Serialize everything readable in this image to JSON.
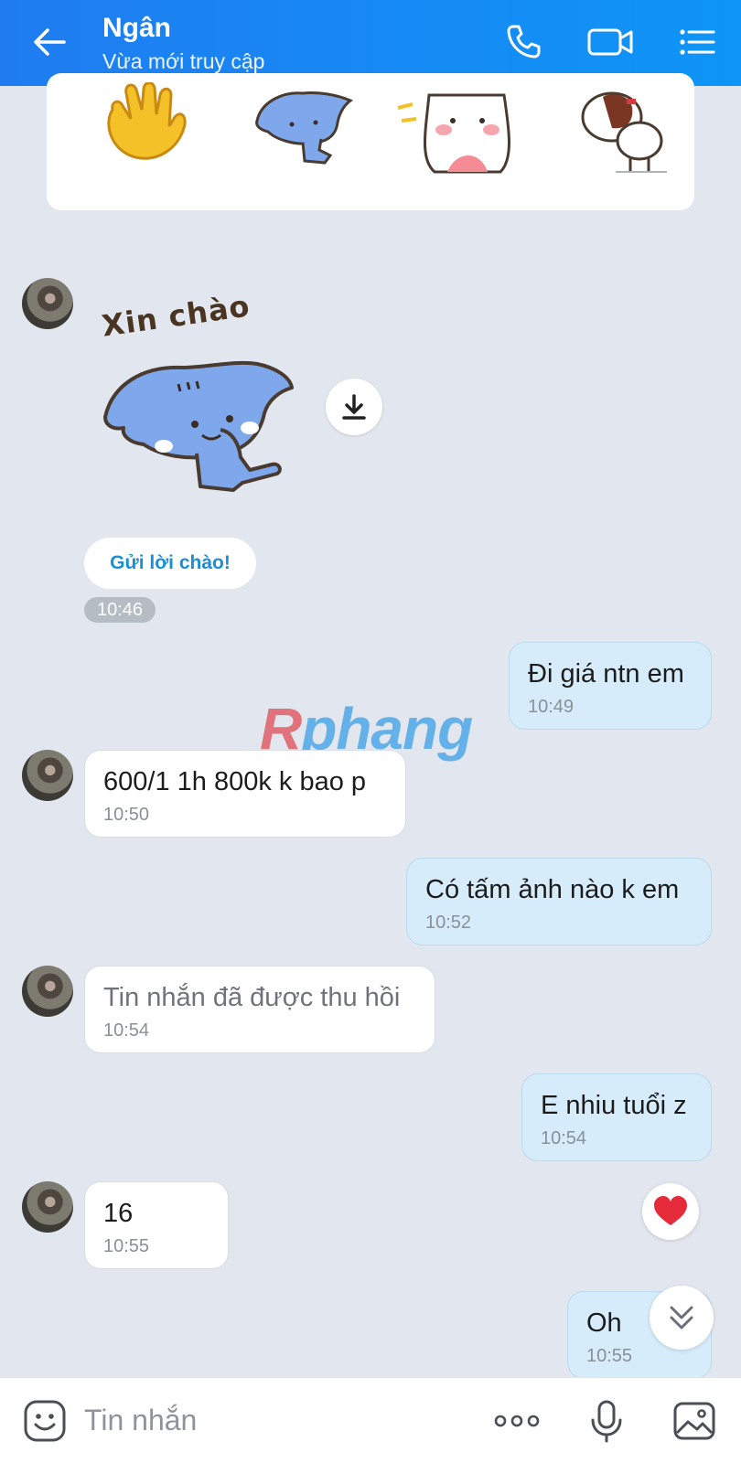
{
  "header": {
    "title": "Ngân",
    "subtitle": "Vừa mới truy cập"
  },
  "icons": {
    "back": "arrow-left",
    "call": "phone",
    "video": "video-camera",
    "menu": "list-menu"
  },
  "sticker_card": {
    "stickers": [
      "waving-hand",
      "blue-cat",
      "white-bunny",
      "dog"
    ]
  },
  "big_sticker": {
    "caption": "Xin chào"
  },
  "greet_button_label": "Gửi lời chào!",
  "greet_time": "10:46",
  "messages": [
    {
      "from": "me",
      "text": "Đi giá ntn em",
      "time": "10:49"
    },
    {
      "from": "them",
      "text": "600/1 1h 800k k bao p",
      "time": "10:50"
    },
    {
      "from": "me",
      "text": "Có tấm ảnh nào k em",
      "time": "10:52"
    },
    {
      "from": "them",
      "text": "Tin nhắn đã được thu hồi",
      "time": "10:54"
    },
    {
      "from": "me",
      "text": "E nhiu tuổi z",
      "time": "10:54"
    },
    {
      "from": "them",
      "text": "16",
      "time": "10:55"
    },
    {
      "from": "me",
      "text": "Oh",
      "time": "10:55"
    }
  ],
  "watermark": {
    "part1": "R",
    "part2": "phang"
  },
  "reaction": "heart",
  "input": {
    "placeholder": "Tin nhắn"
  },
  "colors": {
    "header": "#1f7cf0",
    "outgoing_bubble": "#d6ecfb",
    "incoming_bubble": "#ffffff",
    "background": "#e2e7ef",
    "accent_link": "#1a8fd6"
  }
}
